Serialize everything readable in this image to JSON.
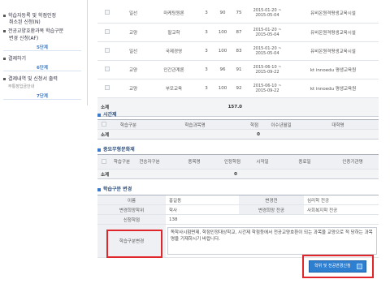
{
  "sidebar": {
    "items": [
      {
        "label": "학습자등록 및 학점인정"
      },
      {
        "label": "취소된 신청(N)"
      },
      {
        "label": "전공교양호환과목 학습구분"
      },
      {
        "label": "변경 신청(AF)"
      },
      {
        "label": "결제하기"
      },
      {
        "label": "결제내역 및 신청서 출력"
      }
    ],
    "steps": [
      "5단계",
      "6단계",
      "7단계"
    ],
    "sub": "무통장입금안내"
  },
  "courses": [
    {
      "type": "일선",
      "name": "마케팅원론",
      "credit": "3",
      "score": "90",
      "grade": "75",
      "date1": "2015-01-20 ~",
      "date2": "2015-05-04",
      "org": "유비온원격평생교육시설"
    },
    {
      "type": "교양",
      "name": "팔교학",
      "credit": "3",
      "score": "100",
      "grade": "87",
      "date1": "2015-01-20 ~",
      "date2": "2015-05-04",
      "org": "유비온원격평생교육시설"
    },
    {
      "type": "일선",
      "name": "국제경영",
      "credit": "3",
      "score": "100",
      "grade": "83",
      "date1": "2015-01-20 ~",
      "date2": "2015-05-04",
      "org": "유비온원격평생교육시설"
    },
    {
      "type": "교양",
      "name": "인간관계론",
      "credit": "3",
      "score": "96",
      "grade": "91",
      "date1": "2015-06-10 ~",
      "date2": "2015-09-22",
      "org": "kt innoedu 평생교육원"
    },
    {
      "type": "교양",
      "name": "부모교육",
      "credit": "3",
      "score": "100",
      "grade": "92",
      "date1": "2015-06-10 ~",
      "date2": "2015-09-22",
      "org": "kt innoedu 평생교육원"
    }
  ],
  "course_total": {
    "label": "소계",
    "value": "157.0"
  },
  "time_section": {
    "title": "시간제",
    "headers": [
      "학습구분",
      "학습과목명",
      "학점",
      "이수년월일",
      "대학명"
    ],
    "total_label": "소계",
    "total_value": "0"
  },
  "cert_section": {
    "title": "중요무형문화재",
    "headers": [
      "학습구분",
      "전승자구분",
      "종목명",
      "인정학점",
      "시작일",
      "종료일",
      "인증기관명"
    ],
    "total_label": "소계",
    "total_value": "0"
  },
  "change_section": {
    "title": "학습구분 변경",
    "name_label": "이름",
    "name_value": "홍길동",
    "major_label": "변경전",
    "major_value": "심리학 전공",
    "degree_label": "변경희망학위",
    "degree_value": "학사",
    "target_label": "변경희망 전공",
    "target_value": "사회복지학 전공",
    "apply_label": "신청학점",
    "apply_value": "138",
    "reason_label": "학습구분변경",
    "reason_text": "독학사시험면제, 학점인정대상학교, 시간제 학점등에서 전공교양호환이 되는 과목을 교양으로 적 당하는 과목명을 기재하시기 바랍니다."
  },
  "submit": {
    "label": "학위 및 전공변경신청"
  }
}
